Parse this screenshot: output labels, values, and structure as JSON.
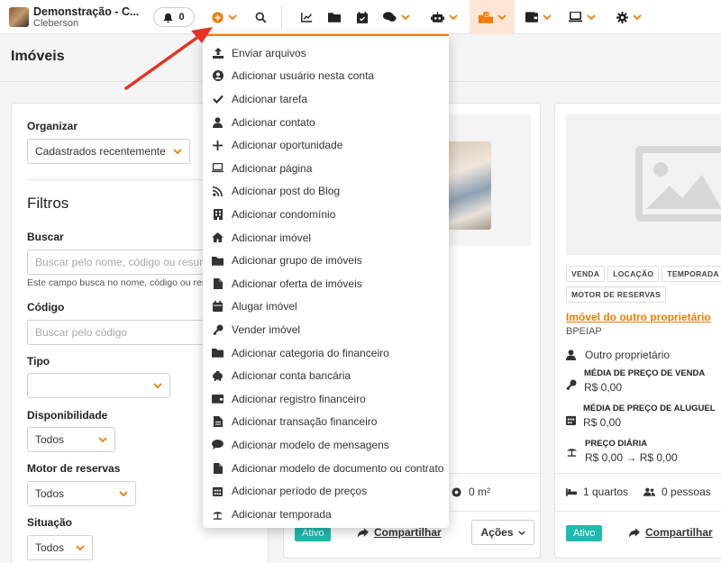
{
  "account": {
    "name": "Demonstração - C...",
    "user": "Cleberson"
  },
  "notifications": {
    "count": "0"
  },
  "colors": {
    "accent": "#f07c00",
    "teal": "#1fbab0",
    "arrow": "#e53222"
  },
  "toolbar": {
    "items": [
      {
        "icon": "plus-circle-icon",
        "dropdown": true,
        "active": true
      },
      {
        "icon": "search-icon"
      },
      {
        "icon": "chart-icon"
      },
      {
        "icon": "folder-icon"
      },
      {
        "icon": "calendar-check-icon"
      },
      {
        "icon": "chat-icon",
        "dropdown": true
      },
      {
        "icon": "robot-icon",
        "dropdown": true
      },
      {
        "icon": "building-icon",
        "dropdown": true,
        "highlighted": true
      },
      {
        "icon": "wallet-icon",
        "dropdown": true
      },
      {
        "icon": "laptop-icon",
        "dropdown": true
      },
      {
        "icon": "gear-icon",
        "dropdown": true
      }
    ]
  },
  "page": {
    "title": "Imóveis"
  },
  "filters": {
    "organize_label": "Organizar",
    "organize_value": "Cadastrados recentemente",
    "title": "Filtros",
    "search_label": "Buscar",
    "search_placeholder": "Buscar pelo nome, código ou resumo",
    "search_help": "Este campo busca no nome, código ou resumo",
    "code_label": "Código",
    "code_placeholder": "Buscar pelo código",
    "type_label": "Tipo",
    "type_value": "",
    "availability_label": "Disponibilidade",
    "availability_value": "Todos",
    "engine_label": "Motor de reservas",
    "engine_value": "Todos",
    "situation_label": "Situação",
    "situation_value": "Todos"
  },
  "menu": {
    "items": [
      {
        "label": "Enviar arquivos",
        "icon": "upload-icon"
      },
      {
        "label": "Adicionar usuário nesta conta",
        "icon": "user-circle-icon"
      },
      {
        "label": "Adicionar tarefa",
        "icon": "check-icon"
      },
      {
        "label": "Adicionar contato",
        "icon": "user-icon"
      },
      {
        "label": "Adicionar oportunidade",
        "icon": "plus-icon"
      },
      {
        "label": "Adicionar página",
        "icon": "laptop-icon"
      },
      {
        "label": "Adicionar post do Blog",
        "icon": "rss-icon"
      },
      {
        "label": "Adicionar condomínio",
        "icon": "building-icon"
      },
      {
        "label": "Adicionar imóvel",
        "icon": "home-icon"
      },
      {
        "label": "Adicionar grupo de imóveis",
        "icon": "folder-icon"
      },
      {
        "label": "Adicionar oferta de imóveis",
        "icon": "file-icon"
      },
      {
        "label": "Alugar imóvel",
        "icon": "calendar-icon"
      },
      {
        "label": "Vender imóvel",
        "icon": "key-icon"
      },
      {
        "label": "Adicionar categoria do financeiro",
        "icon": "folder-icon"
      },
      {
        "label": "Adicionar conta bancária",
        "icon": "piggy-bank-icon"
      },
      {
        "label": "Adicionar registro financeiro",
        "icon": "wallet-icon"
      },
      {
        "label": "Adicionar transação financeiro",
        "icon": "file-text-icon"
      },
      {
        "label": "Adicionar modelo de mensagens",
        "icon": "comment-icon"
      },
      {
        "label": "Adicionar modelo de documento ou contrato",
        "icon": "file-icon"
      },
      {
        "label": "Adicionar período de preços",
        "icon": "calendar-grid-icon"
      },
      {
        "label": "Adicionar temporada",
        "icon": "umbrella-beach-icon"
      }
    ]
  },
  "card1": {
    "area": "0 m²",
    "status": "Ativo",
    "share": "Compartilhar",
    "actions": "Ações"
  },
  "card2": {
    "tags": [
      "VENDA",
      "LOCAÇÃO",
      "TEMPORADA",
      "MOTOR DE RESERVAS"
    ],
    "title": "Imóvel do outro proprietário",
    "code": "BPEIAP",
    "owner": "Outro proprietário",
    "sale_label": "MÉDIA DE PREÇO DE VENDA",
    "sale_value": "R$ 0,00",
    "rent_label": "MÉDIA DE PREÇO DE ALUGUEL",
    "rent_value": "R$ 0,00",
    "daily_label": "PREÇO DIÁRIA",
    "daily_value": "R$ 0,00 → R$ 0,00",
    "rooms": "1 quartos",
    "people": "0 pessoas",
    "status": "Ativo",
    "share": "Compartilhar"
  }
}
